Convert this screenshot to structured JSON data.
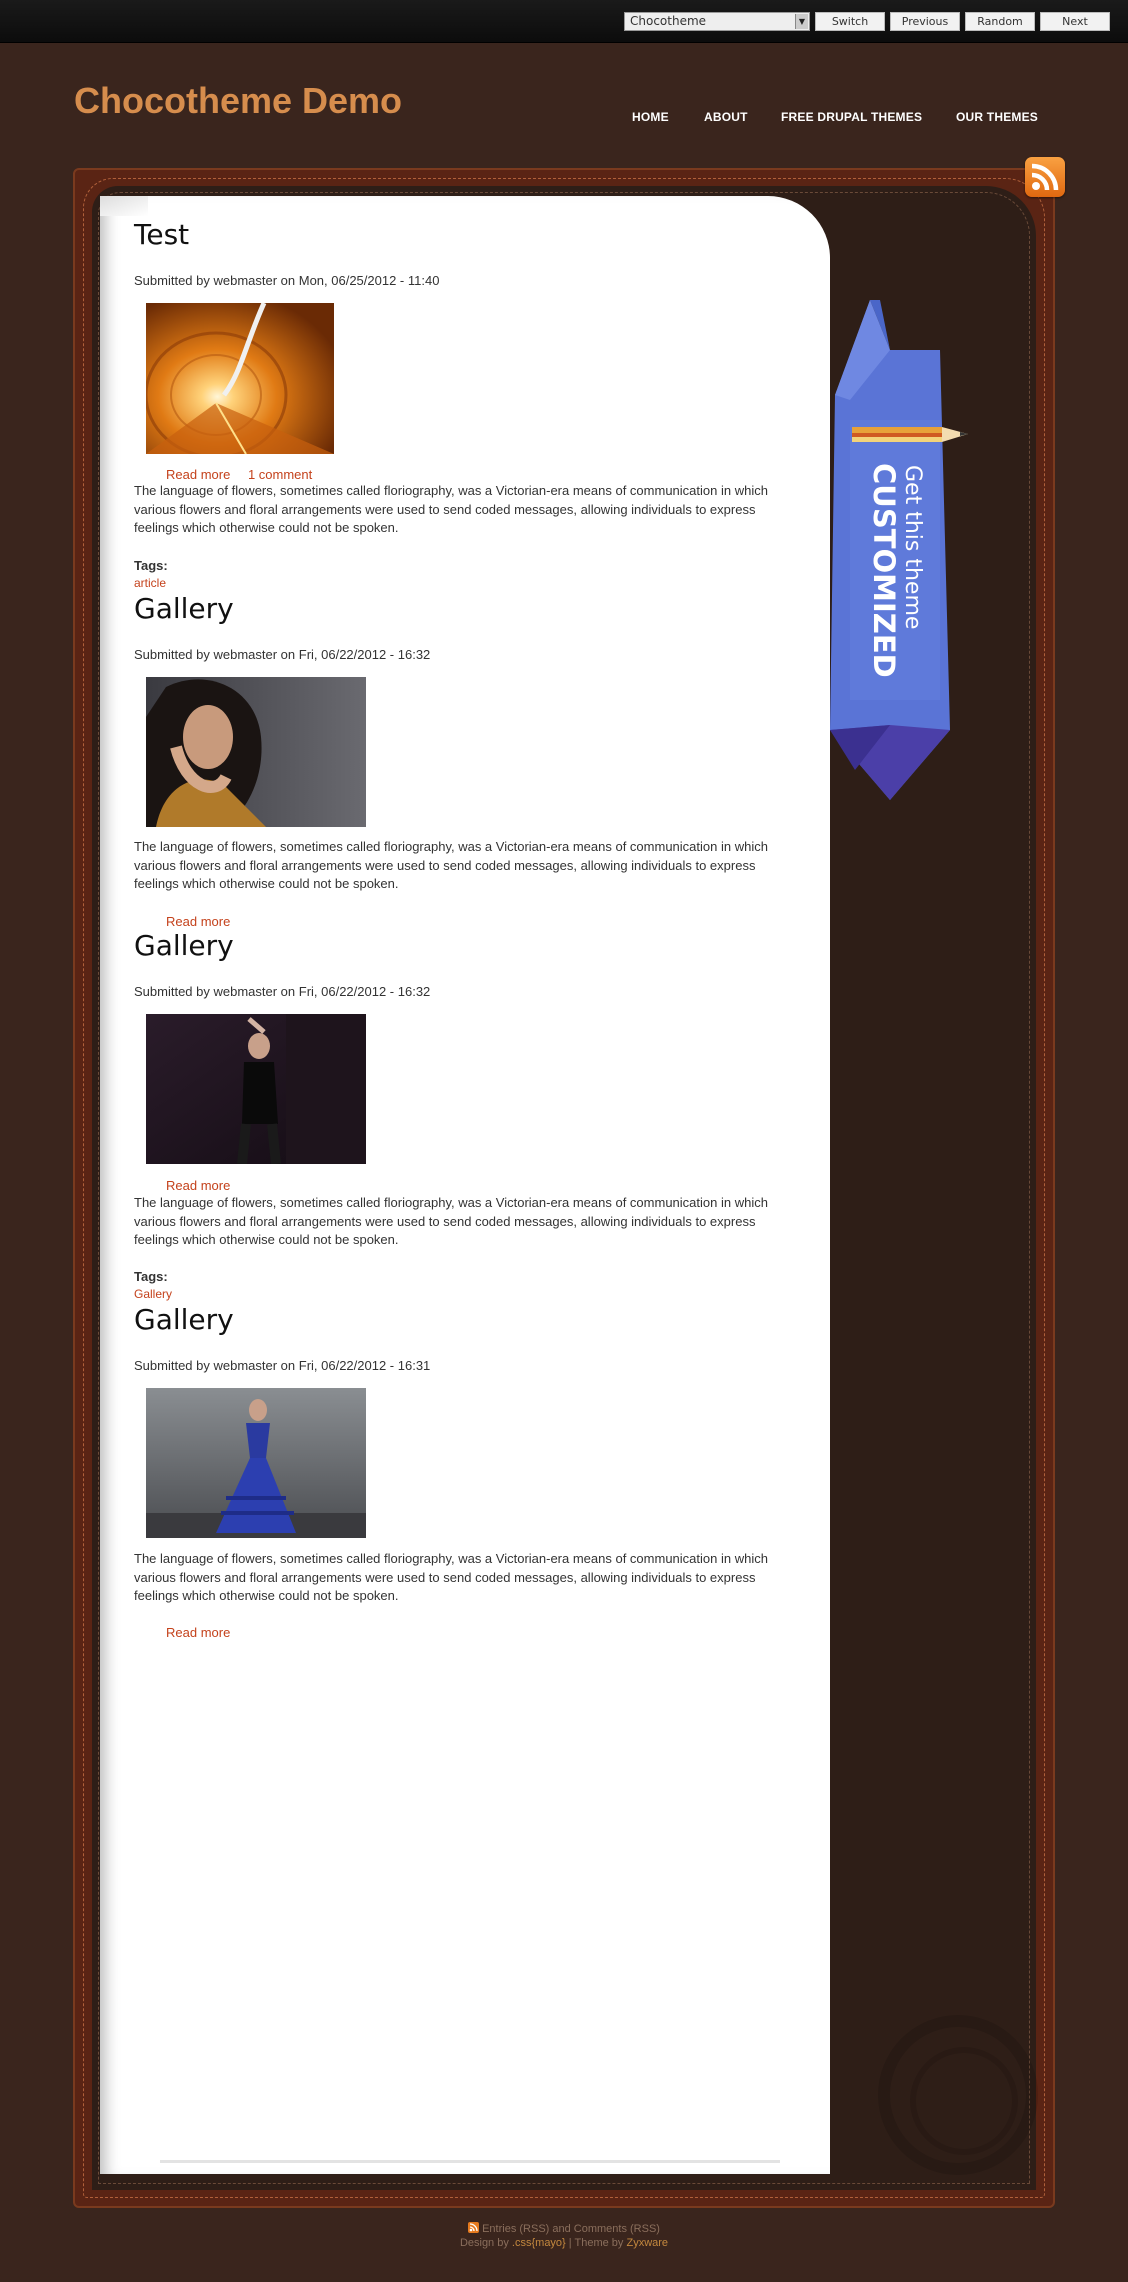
{
  "switcher": {
    "selected": "Chocotheme",
    "switch_label": "Switch",
    "previous_label": "Previous",
    "random_label": "Random",
    "next_label": "Next"
  },
  "site": {
    "name": "Chocotheme Demo"
  },
  "nav": [
    {
      "label": "HOME"
    },
    {
      "label": "ABOUT"
    },
    {
      "label": "FREE DRUPAL THEMES"
    },
    {
      "label": "OUR THEMES"
    }
  ],
  "ribbon": {
    "line1": "Get this theme",
    "line2": "CUSTOMIZED"
  },
  "nodes": [
    {
      "title": "Test",
      "submitted": "Submitted by webmaster on Mon, 06/25/2012 - 11:40",
      "image": "tunnel",
      "read_more": "Read more",
      "comments": "1 comment",
      "body": "The language of flowers, sometimes called floriography, was a Victorian-era means of communication in which various flowers and floral arrangements were used to send coded messages, allowing individuals to express feelings which otherwise could not be spoken.",
      "tags_label": "Tags:",
      "tag": "article"
    },
    {
      "title": "Gallery",
      "submitted": "Submitted by webmaster on Fri, 06/22/2012 - 16:32",
      "image": "woman-portrait",
      "body": "The language of flowers, sometimes called floriography, was a Victorian-era means of communication in which various flowers and floral arrangements were used to send coded messages, allowing individuals to express feelings which otherwise could not be spoken.",
      "read_more": "Read more"
    },
    {
      "title": "Gallery",
      "submitted": "Submitted by webmaster on Fri, 06/22/2012 - 16:32",
      "image": "woman-dark-dress",
      "read_more": "Read more",
      "body": "The language of flowers, sometimes called floriography, was a Victorian-era means of communication in which various flowers and floral arrangements were used to send coded messages, allowing individuals to express feelings which otherwise could not be spoken.",
      "tags_label": "Tags:",
      "tag": "Gallery"
    },
    {
      "title": "Gallery",
      "submitted": "Submitted by webmaster on Fri, 06/22/2012 - 16:31",
      "image": "woman-blue-dress",
      "body": "The language of flowers, sometimes called floriography, was a Victorian-era means of communication in which various flowers and floral arrangements were used to send coded messages, allowing individuals to express feelings which otherwise could not be spoken.",
      "read_more": "Read more"
    }
  ],
  "footer": {
    "feeds": "Entries (RSS) and Comments (RSS)",
    "design_prefix": "Design by",
    "designer": ".css{mayo}",
    "theme_prefix": "| Theme by",
    "theme_author": "Zyxware"
  },
  "icons": {
    "rss": "rss-icon",
    "watermark": "wordpress-logo-icon"
  },
  "colors": {
    "accent": "#d68d4d",
    "link": "#c4421c",
    "background": "#3a251d"
  }
}
